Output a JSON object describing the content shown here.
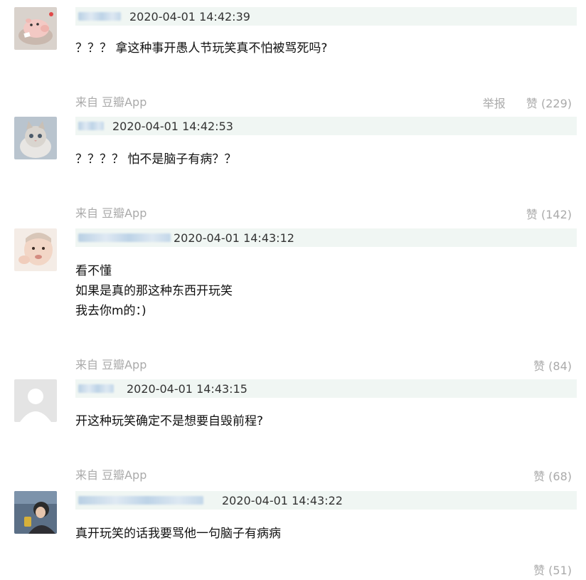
{
  "comments": [
    {
      "time": "2020-04-01 14:42:39",
      "lines": [
        "？？？ 拿这种事开愚人节玩笑真不怕被骂死吗?"
      ],
      "source": "来自 豆瓣App",
      "report_label": "举报",
      "like_label": "赞 (229)",
      "avatar_icon": "pink-pig-toy-avatar"
    },
    {
      "time": "2020-04-01 14:42:53",
      "lines": [
        "？？？？ 怕不是脑子有病？？"
      ],
      "source": "来自 豆瓣App",
      "like_label": "赞 (142)",
      "avatar_icon": "kitten-avatar"
    },
    {
      "time": "2020-04-01 14:43:12",
      "lines": [
        "看不懂",
        "如果是真的那这种东西开玩笑",
        "我去你m的：)"
      ],
      "source": "来自 豆瓣App",
      "like_label": "赞 (84)",
      "avatar_icon": "baby-avatar"
    },
    {
      "time": "2020-04-01 14:43:15",
      "lines": [
        "开这种玩笑确定不是想要自毁前程?"
      ],
      "source": "来自 豆瓣App",
      "like_label": "赞 (68)",
      "avatar_icon": "default-user-avatar"
    },
    {
      "time": "2020-04-01 14:43:22",
      "lines": [
        "真开玩笑的话我要骂他一句脑子有病病"
      ],
      "like_label": "赞 (51)",
      "avatar_icon": "person-photo-avatar"
    }
  ],
  "colors": {
    "meta_bar": "#f0f6f3",
    "muted_text": "#aaaaaa",
    "blurred_name": "#bdd3e7"
  }
}
